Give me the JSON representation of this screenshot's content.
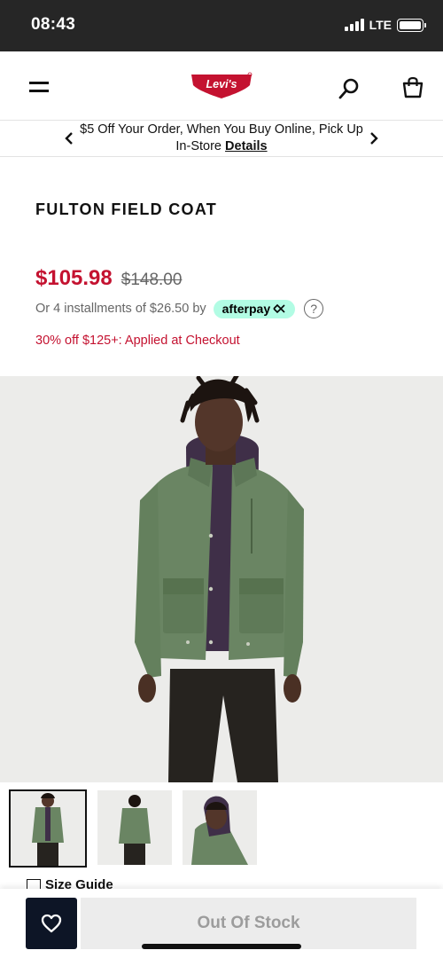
{
  "status_bar": {
    "time": "08:43",
    "network": "LTE"
  },
  "header": {
    "logo_text": "Levi's",
    "brand_color": "#c41230"
  },
  "promo": {
    "text": "$5 Off Your Order, When You Buy Online, Pick Up In-Store",
    "link_label": "Details"
  },
  "product": {
    "title": "FULTON FIELD COAT",
    "sale_price": "$105.98",
    "original_price": "$148.00",
    "installments_text": "Or 4 installments of $26.50 by",
    "afterpay_label": "afterpay",
    "help_symbol": "?",
    "discount_note": "30% off $125+: Applied at Checkout",
    "sale_color": "#c41230",
    "afterpay_color": "#b2fce4"
  },
  "gallery": {
    "coat_color": "#6a8563",
    "background_color": "#ececea"
  },
  "size_guide": {
    "label": "Size Guide"
  },
  "actions": {
    "out_of_stock_label": "Out Of Stock",
    "wishlist_icon": "heart-icon"
  }
}
